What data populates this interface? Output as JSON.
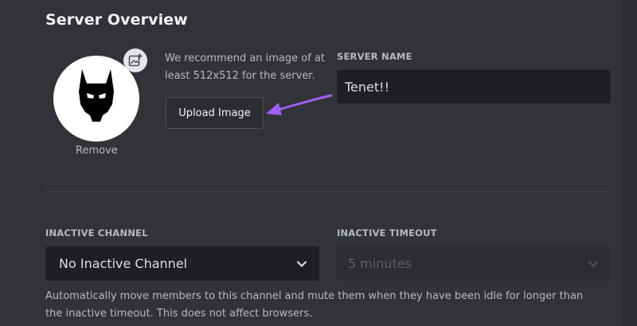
{
  "section": {
    "title": "Server Overview"
  },
  "avatar": {
    "icon": "batman-mask-icon",
    "badge_icon": "add-image-icon",
    "remove_label": "Remove"
  },
  "upload": {
    "recommendation": "We recommend an image of at least 512x512 for the server.",
    "button_label": "Upload Image",
    "annotation_color": "#a15ef0"
  },
  "server_name": {
    "label": "SERVER NAME",
    "value": "Tenet!!"
  },
  "inactive_channel": {
    "label": "INACTIVE CHANNEL",
    "selected": "No Inactive Channel"
  },
  "inactive_timeout": {
    "label": "INACTIVE TIMEOUT",
    "selected": "5 minutes"
  },
  "help": {
    "text": "Automatically move members to this channel and mute them when they have been idle for longer than the inactive timeout. This does not affect browsers."
  },
  "colors": {
    "background": "#313338",
    "input": "#1e1f22",
    "text": "#dbdee1",
    "muted": "#b5bac1"
  }
}
